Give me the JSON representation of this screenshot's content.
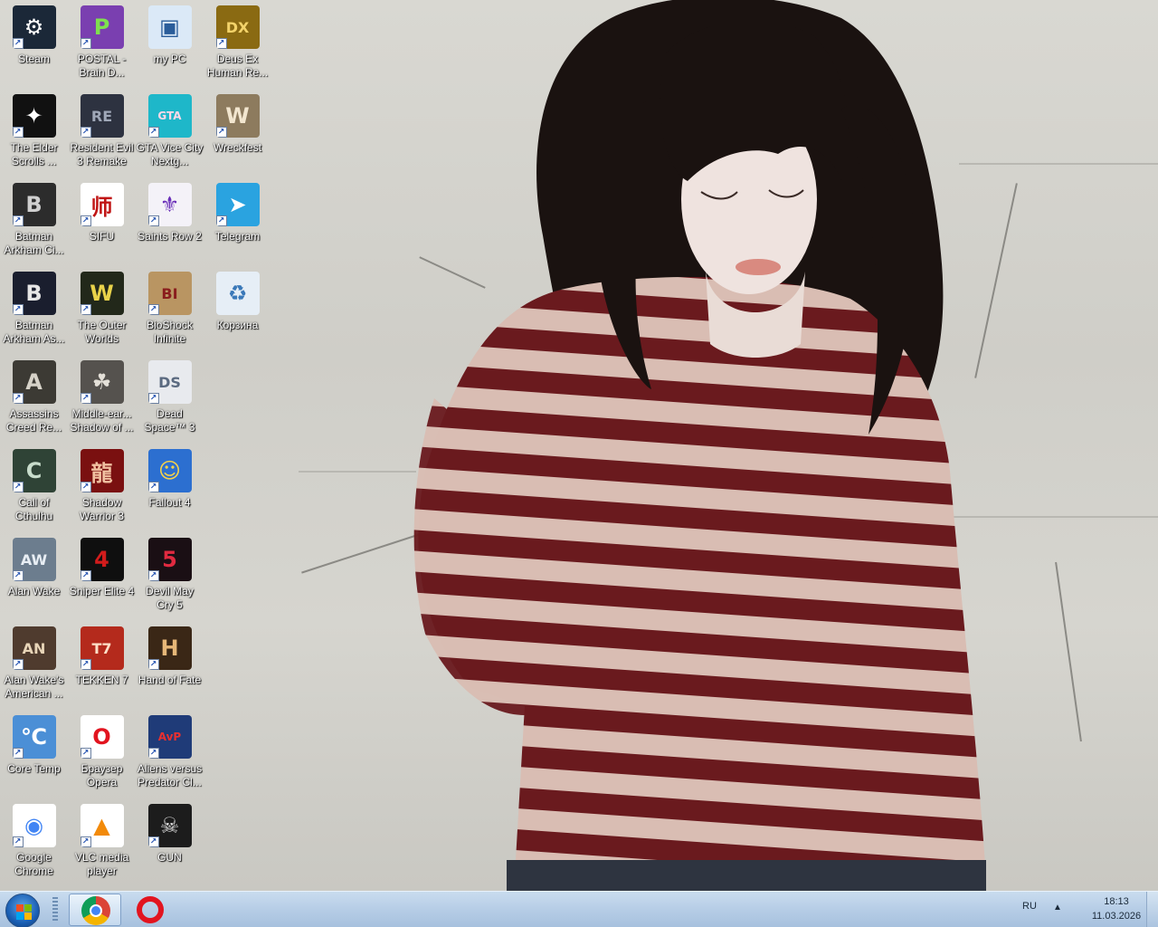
{
  "desktop": {
    "icons": [
      {
        "label": "Steam",
        "icon": "steam-icon",
        "bg": "#1b2838",
        "fg": "#ffffff",
        "glyph": "⚙"
      },
      {
        "label": "POSTAL - Brain D...",
        "icon": "postal-icon",
        "bg": "#7a3fb0",
        "fg": "#7fe04f",
        "glyph": "P"
      },
      {
        "label": "my PC",
        "icon": "computer-icon",
        "bg": "#dbe9f7",
        "fg": "#2a5d9a",
        "glyph": "▣"
      },
      {
        "label": "Deus Ex Human Re...",
        "icon": "deus-ex-icon",
        "bg": "#8a6a12",
        "fg": "#f3d36a",
        "glyph": "DX"
      },
      {
        "label": "The Elder Scrolls ...",
        "icon": "elder-scrolls-icon",
        "bg": "#111111",
        "fg": "#ffffff",
        "glyph": "✦"
      },
      {
        "label": "Resident Evil 3 Remake",
        "icon": "resident-evil-icon",
        "bg": "#2d3240",
        "fg": "#a0a8b8",
        "glyph": "RE"
      },
      {
        "label": "GTA Vice City Nextg...",
        "icon": "gta-vice-city-icon",
        "bg": "#1eb7c9",
        "fg": "#ffd9e8",
        "glyph": "GTA"
      },
      {
        "label": "Wreckfest",
        "icon": "wreckfest-icon",
        "bg": "#8d7b5e",
        "fg": "#f2e6cf",
        "glyph": "W"
      },
      {
        "label": "Batman Arkham Ci...",
        "icon": "batman-city-icon",
        "bg": "#2c2c2c",
        "fg": "#cfcfcf",
        "glyph": "B"
      },
      {
        "label": "SIFU",
        "icon": "sifu-icon",
        "bg": "#ffffff",
        "fg": "#c01414",
        "glyph": "师"
      },
      {
        "label": "Saints Row 2",
        "icon": "saints-row-icon",
        "bg": "#f4f2f8",
        "fg": "#6a2fb8",
        "glyph": "⚜"
      },
      {
        "label": "Telegram",
        "icon": "telegram-icon",
        "bg": "#2aa3e0",
        "fg": "#ffffff",
        "glyph": "➤"
      },
      {
        "label": "Batman Arkham As...",
        "icon": "batman-asylum-icon",
        "bg": "#1a1e2e",
        "fg": "#e6e6e6",
        "glyph": "B"
      },
      {
        "label": "The Outer Worlds",
        "icon": "outer-worlds-icon",
        "bg": "#22281a",
        "fg": "#e8d24a",
        "glyph": "W"
      },
      {
        "label": "BioShock Infinite",
        "icon": "bioshock-icon",
        "bg": "#b99562",
        "fg": "#8a1d1d",
        "glyph": "BI"
      },
      {
        "label": "Корзина",
        "icon": "recycle-bin-icon",
        "bg": "#e6eef6",
        "fg": "#3a78b8",
        "glyph": "♻"
      },
      {
        "label": "Assassins Creed Re...",
        "icon": "assassins-creed-icon",
        "bg": "#3c3a34",
        "fg": "#d6d2c8",
        "glyph": "A"
      },
      {
        "label": "Middle-ear... Shadow of ...",
        "icon": "middle-earth-icon",
        "bg": "#55524e",
        "fg": "#e4e0d8",
        "glyph": "☘"
      },
      {
        "label": "Dead Space™ 3",
        "icon": "dead-space-icon",
        "bg": "#e8eaee",
        "fg": "#5b6a80",
        "glyph": "DS"
      },
      {
        "label": "Call of Cthulhu",
        "icon": "call-of-cthulhu-icon",
        "bg": "#2f4336",
        "fg": "#c8dccb",
        "glyph": "C"
      },
      {
        "label": "Shadow Warrior 3",
        "icon": "shadow-warrior-icon",
        "bg": "#7a1010",
        "fg": "#f0c0a0",
        "glyph": "龍"
      },
      {
        "label": "Fallout 4",
        "icon": "fallout-icon",
        "bg": "#2c6fd0",
        "fg": "#f6d24a",
        "glyph": "☺"
      },
      {
        "label": "Alan Wake",
        "icon": "alan-wake-icon",
        "bg": "#6c7d8e",
        "fg": "#e8eef4",
        "glyph": "AW"
      },
      {
        "label": "Sniper Elite 4",
        "icon": "sniper-elite-icon",
        "bg": "#0f0f0f",
        "fg": "#d21c1c",
        "glyph": "4"
      },
      {
        "label": "Devil May Cry 5",
        "icon": "devil-may-cry-icon",
        "bg": "#1a0f14",
        "fg": "#e02a40",
        "glyph": "5"
      },
      {
        "label": "Alan Wake's American ...",
        "icon": "alan-wake-american-icon",
        "bg": "#4f3b2e",
        "fg": "#e8d5b8",
        "glyph": "AN"
      },
      {
        "label": "TEKKEN 7",
        "icon": "tekken-icon",
        "bg": "#b42a1c",
        "fg": "#ffe0c8",
        "glyph": "T7"
      },
      {
        "label": "Hand of Fate",
        "icon": "hand-of-fate-icon",
        "bg": "#3a2716",
        "fg": "#e6b778",
        "glyph": "H"
      },
      {
        "label": "Core Temp",
        "icon": "core-temp-icon",
        "bg": "#4b8fd6",
        "fg": "#ffffff",
        "glyph": "℃"
      },
      {
        "label": "Браузер Opera",
        "icon": "opera-icon",
        "bg": "#ffffff",
        "fg": "#e2141f",
        "glyph": "O"
      },
      {
        "label": "Aliens versus Predator Cl...",
        "icon": "aliens-vs-predator-icon",
        "bg": "#1f3b78",
        "fg": "#e83030",
        "glyph": "AvP"
      },
      {
        "label": "Google Chrome",
        "icon": "chrome-icon",
        "bg": "#ffffff",
        "fg": "#4285f4",
        "glyph": "◉"
      },
      {
        "label": "VLC media player",
        "icon": "vlc-icon",
        "bg": "#ffffff",
        "fg": "#f28a0a",
        "glyph": "▲"
      },
      {
        "label": "GUN",
        "icon": "gun-icon",
        "bg": "#1c1c1c",
        "fg": "#dcdcdc",
        "glyph": "☠"
      }
    ]
  },
  "taskbar": {
    "pinned": [
      {
        "name": "Google Chrome",
        "icon": "chrome-icon",
        "active": true
      },
      {
        "name": "Opera",
        "icon": "opera-icon",
        "active": false
      }
    ],
    "tray": {
      "language": "RU",
      "arrow": "▲",
      "time": "18:13",
      "date": "11.03.2026"
    }
  },
  "colors": {
    "shirt_stripe_dark": "#6a1a1e",
    "shirt_stripe_light": "#d9bdb3",
    "hair": "#1a1210",
    "wall": "#d3d2cc"
  }
}
